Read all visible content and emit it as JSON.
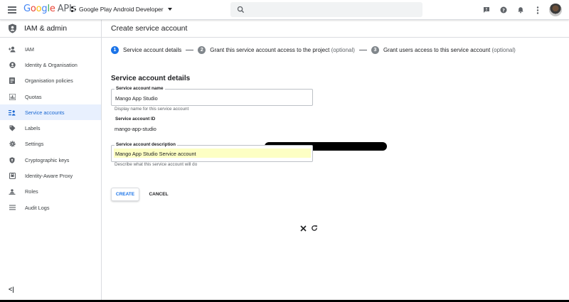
{
  "topbar": {
    "logo_google": "Google",
    "logo_apis": "APIs",
    "project_name": "Google Play Android Developer",
    "icons": [
      "menu-icon",
      "project-icon",
      "dropdown-icon",
      "search-icon",
      "feedback-icon",
      "help-icon",
      "notifications-icon",
      "more-icon",
      "avatar"
    ]
  },
  "sidebar": {
    "title": "IAM & admin",
    "items": [
      {
        "label": "IAM",
        "icon": "person-add-icon"
      },
      {
        "label": "Identity & Organisation",
        "icon": "account-circle-icon"
      },
      {
        "label": "Organisation policies",
        "icon": "policy-doc-icon"
      },
      {
        "label": "Quotas",
        "icon": "quota-chart-icon"
      },
      {
        "label": "Service accounts",
        "icon": "service-account-icon",
        "active": true
      },
      {
        "label": "Labels",
        "icon": "label-icon"
      },
      {
        "label": "Settings",
        "icon": "gear-icon"
      },
      {
        "label": "Cryptographic keys",
        "icon": "shield-key-icon"
      },
      {
        "label": "Identity-Aware Proxy",
        "icon": "proxy-icon"
      },
      {
        "label": "Roles",
        "icon": "roles-icon"
      },
      {
        "label": "Audit Logs",
        "icon": "list-icon"
      }
    ],
    "collapse_label": "<|"
  },
  "main": {
    "page_title": "Create service account",
    "steps": [
      {
        "num": "1",
        "label": "Service account details",
        "optional": ""
      },
      {
        "num": "2",
        "label": "Grant this service account access to the project",
        "optional": "(optional)"
      },
      {
        "num": "3",
        "label": "Grant users access to this service account",
        "optional": "(optional)"
      }
    ],
    "section_title": "Service account details",
    "fields": {
      "name": {
        "label": "Service account name",
        "value": "Mango App Studio",
        "hint": "Display name for this service account"
      },
      "id": {
        "label": "Service account ID",
        "value": "mango-app-studio"
      },
      "description": {
        "label": "Service account description",
        "value": "Mango App Studio Service account",
        "hint": "Describe what this service account will do"
      }
    },
    "buttons": {
      "create": "CREATE",
      "cancel": "CANCEL"
    }
  },
  "colors": {
    "accent": "#1a73e8",
    "active_nav_bg": "#e8f0fe",
    "highlight": "#fdffc4"
  }
}
